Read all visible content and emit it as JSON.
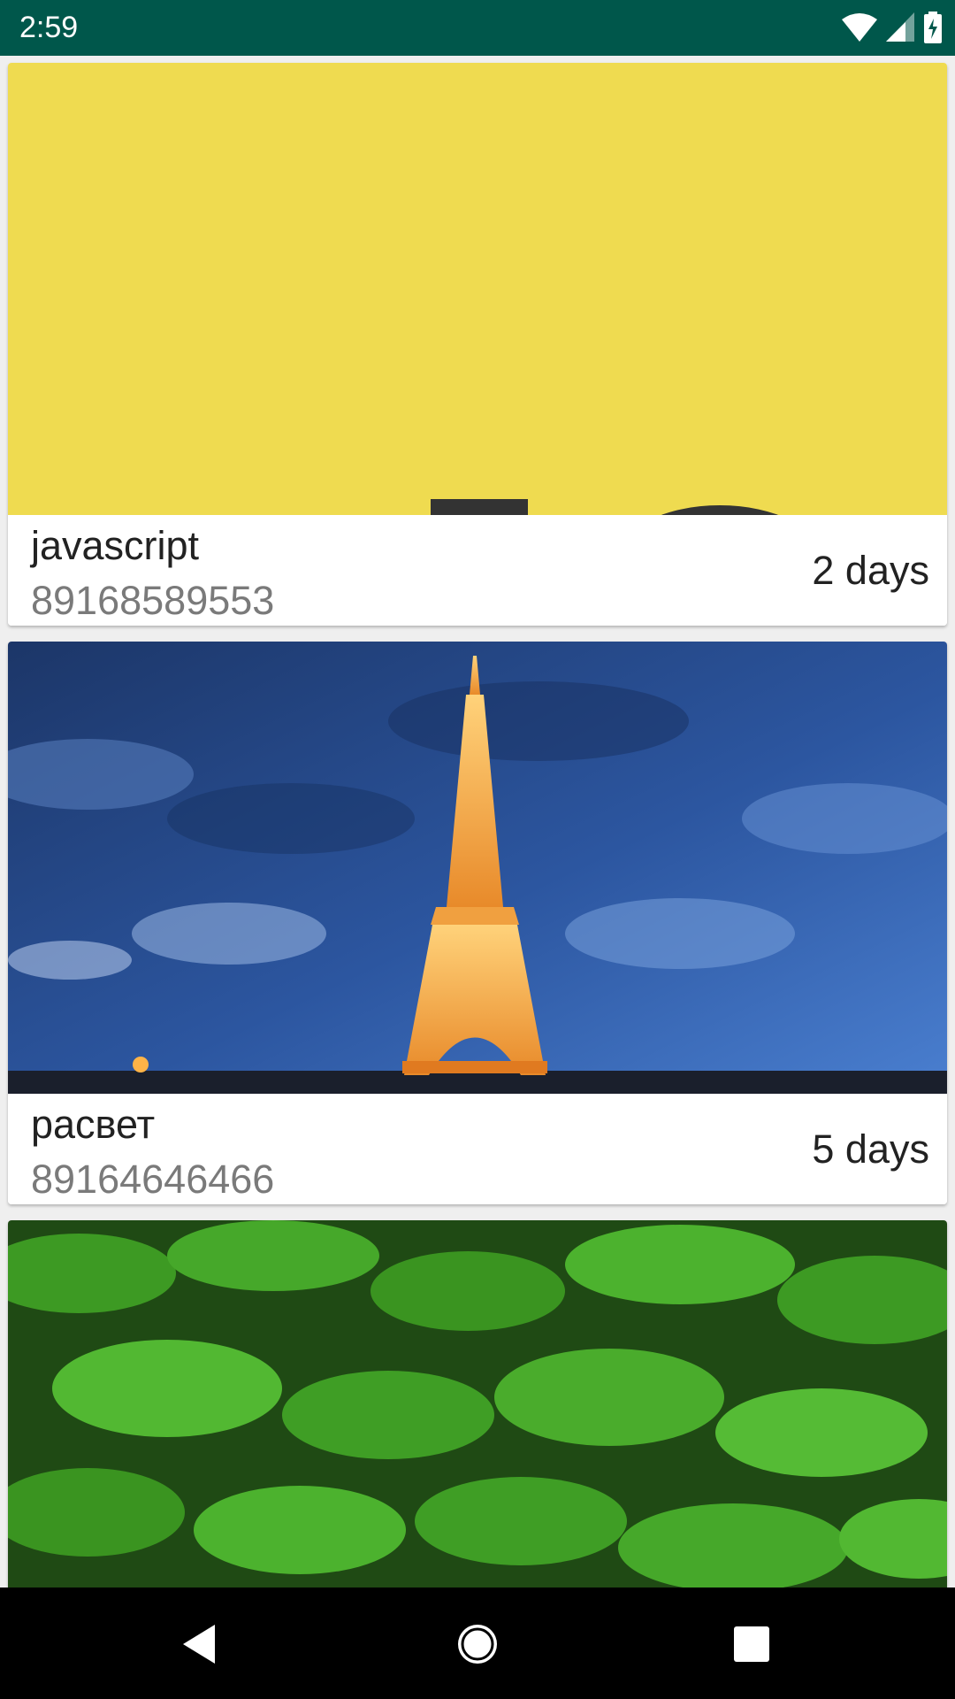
{
  "status_bar": {
    "time": "2:59",
    "icons": [
      "wifi-icon",
      "cell-signal-icon",
      "battery-charging-icon"
    ],
    "background": "#00574b"
  },
  "cards": [
    {
      "title": "javascript",
      "phone": "89168589553",
      "age": "2 days",
      "image": "js-logo-yellow"
    },
    {
      "title": "расвет",
      "phone": "89164646466",
      "age": "5 days",
      "image": "eiffel-tower-night"
    },
    {
      "title": "",
      "phone": "",
      "age": "",
      "image": "green-ferns"
    }
  ],
  "nav_bar": {
    "icons": [
      "back-icon",
      "home-icon",
      "recents-icon"
    ]
  }
}
